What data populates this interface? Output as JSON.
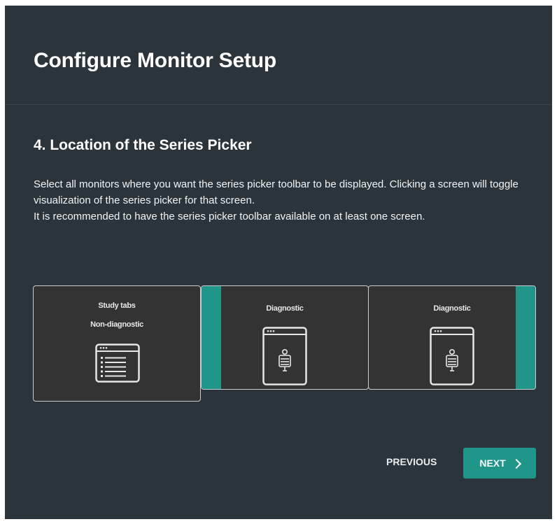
{
  "dialog": {
    "title": "Configure Monitor Setup"
  },
  "step": {
    "title": "4. Location of the Series Picker",
    "description_line1": "Select all monitors where you want the series picker toolbar to be displayed. Clicking a screen will toggle visualization of the series picker for that screen.",
    "description_line2": "It is recommended to have the series picker toolbar available on at least one screen."
  },
  "monitors": [
    {
      "label_primary": "Study tabs",
      "label_secondary": "Non-diagnostic",
      "icon": "list-window-icon",
      "selected": true,
      "series_picker": "none"
    },
    {
      "label_primary": "Diagnostic",
      "icon": "image-viewer-icon",
      "series_picker": "left"
    },
    {
      "label_primary": "Diagnostic",
      "icon": "image-viewer-icon",
      "series_picker": "right"
    }
  ],
  "footer": {
    "previous_label": "PREVIOUS",
    "next_label": "NEXT",
    "next_icon": "chevron-right-icon"
  },
  "colors": {
    "background": "#2b343b",
    "accent": "#20958a",
    "monitor_bg": "#333333",
    "monitor_border": "#c9cdcf"
  }
}
